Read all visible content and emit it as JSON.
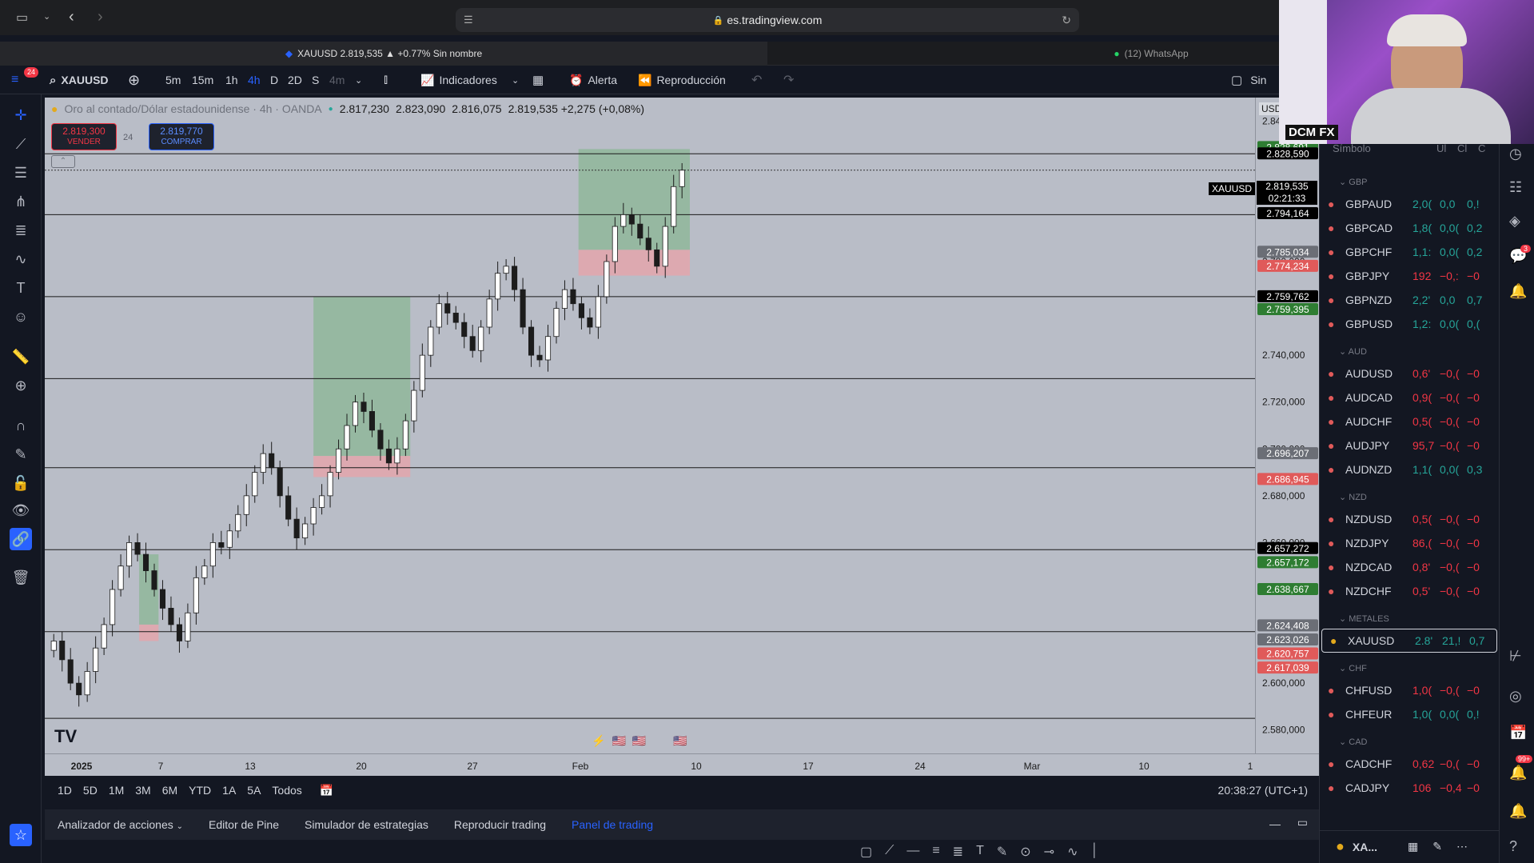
{
  "browser": {
    "url": "es.tradingview.com",
    "tabs": [
      {
        "label": "XAUUSD 2.819,535 ▲ +0.77% Sin nombre"
      },
      {
        "label": "(12) WhatsApp"
      }
    ]
  },
  "toolbar": {
    "notif_count": "24",
    "symbol": "XAUUSD",
    "intervals": [
      "5m",
      "15m",
      "1h",
      "4h",
      "D",
      "2D",
      "S",
      "4m"
    ],
    "active_interval": "4h",
    "indicators_label": "Indicadores",
    "alert_label": "Alerta",
    "replay_label": "Reproducción",
    "layout_label": "Sin"
  },
  "legend": {
    "title": "Oro al contado/Dólar estadounidense · 4h · OANDA",
    "open": "2.817,230",
    "high": "2.823,090",
    "low": "2.816,075",
    "close": "2.819,535 +2,275 (+0,08%)"
  },
  "trade": {
    "sell_price": "2.819,300",
    "sell_label": "VENDER",
    "spread": "24",
    "buy_price": "2.819,770",
    "buy_label": "COMPRAR"
  },
  "scale": {
    "currency": "USD",
    "symbol_tag": "XAUUSD",
    "current_price": "2.819,535",
    "countdown": "02:21:33"
  },
  "chart_data": {
    "type": "candlestick",
    "ylim": [
      2570,
      2850
    ],
    "yticks": [
      "2.840,000",
      "2.800,000",
      "2.780,000",
      "2.740,000",
      "2.720,000",
      "2.700,000",
      "2.680,000",
      "2.660,000",
      "2.600,000",
      "2.580,000"
    ],
    "xticks": [
      "2025",
      "7",
      "13",
      "20",
      "27",
      "Feb",
      "10",
      "17",
      "24",
      "Mar",
      "10",
      "1"
    ],
    "horizontal_levels": [
      2826,
      2800,
      2765,
      2730,
      2692,
      2657,
      2622,
      2585
    ],
    "price_labels": [
      {
        "text": "2.828,691",
        "value": 2828.7,
        "color": "#2e7d32"
      },
      {
        "text": "2.828,590",
        "value": 2826.0,
        "color": "#000000"
      },
      {
        "text": "2.794,164",
        "value": 2800.5,
        "color": "#000000"
      },
      {
        "text": "2.785,034",
        "value": 2784.0,
        "color": "#6b6e76"
      },
      {
        "text": "2.774,234",
        "value": 2778.0,
        "color": "#e05a5a"
      },
      {
        "text": "2.759,762",
        "value": 2765.0,
        "color": "#000000"
      },
      {
        "text": "2.759,395",
        "value": 2759.5,
        "color": "#2e7d32"
      },
      {
        "text": "2.696,207",
        "value": 2698.0,
        "color": "#6b6e76"
      },
      {
        "text": "2.686,945",
        "value": 2687.0,
        "color": "#e05a5a"
      },
      {
        "text": "2.657,272",
        "value": 2657.5,
        "color": "#000000"
      },
      {
        "text": "2.657,172",
        "value": 2651.5,
        "color": "#2e7d32"
      },
      {
        "text": "2.638,667",
        "value": 2640.0,
        "color": "#2e7d32"
      },
      {
        "text": "2.624,408",
        "value": 2624.5,
        "color": "#6b6e76"
      },
      {
        "text": "2.623,026",
        "value": 2618.5,
        "color": "#6b6e76"
      },
      {
        "text": "2.620,757",
        "value": 2612.5,
        "color": "#e05a5a"
      },
      {
        "text": "2.617,039",
        "value": 2606.5,
        "color": "#e05a5a"
      }
    ],
    "zones": [
      {
        "kind": "profit",
        "x0": 0.078,
        "x1": 0.094,
        "y0": 2655,
        "y1": 2625
      },
      {
        "kind": "loss",
        "x0": 0.078,
        "x1": 0.094,
        "y0": 2625,
        "y1": 2618
      },
      {
        "kind": "profit",
        "x0": 0.222,
        "x1": 0.302,
        "y0": 2765,
        "y1": 2697
      },
      {
        "kind": "loss",
        "x0": 0.222,
        "x1": 0.302,
        "y0": 2697,
        "y1": 2688
      },
      {
        "kind": "profit",
        "x0": 0.441,
        "x1": 0.533,
        "y0": 2828,
        "y1": 2785
      },
      {
        "kind": "loss",
        "x0": 0.441,
        "x1": 0.533,
        "y0": 2785,
        "y1": 2774
      }
    ],
    "close_series": [
      2618,
      2610,
      2600,
      2595,
      2605,
      2615,
      2625,
      2640,
      2650,
      2660,
      2655,
      2648,
      2640,
      2632,
      2625,
      2618,
      2630,
      2645,
      2650,
      2660,
      2658,
      2665,
      2672,
      2680,
      2690,
      2698,
      2692,
      2680,
      2670,
      2662,
      2668,
      2675,
      2680,
      2690,
      2700,
      2710,
      2720,
      2716,
      2708,
      2700,
      2694,
      2700,
      2712,
      2725,
      2740,
      2752,
      2762,
      2758,
      2754,
      2748,
      2742,
      2752,
      2764,
      2775,
      2778,
      2768,
      2752,
      2740,
      2738,
      2748,
      2760,
      2768,
      2762,
      2756,
      2752,
      2765,
      2780,
      2795,
      2800,
      2796,
      2790,
      2785,
      2778,
      2795,
      2812,
      2819
    ]
  },
  "range_bar": {
    "ranges": [
      "1D",
      "5D",
      "1M",
      "3M",
      "6M",
      "YTD",
      "1A",
      "5A",
      "Todos"
    ],
    "clock": "20:38:27 (UTC+1)"
  },
  "bottom_tabs": [
    "Analizador de acciones",
    "Editor de Pine",
    "Simulador de estrategias",
    "Reproducir trading",
    "Panel de trading"
  ],
  "active_bottom_tab": "Panel de trading",
  "webcam": {
    "label": "DCM FX"
  },
  "watchlist": {
    "header": {
      "symbol": "Símbolo",
      "c1": "Úl",
      "c2": "Cl",
      "c3": "C"
    },
    "groups": [
      {
        "name": "GBP",
        "items": [
          {
            "symbol": "GBPAUD",
            "last": "2,0(",
            "chg": "0,0",
            "pct": "0,!",
            "color": "#26a69a"
          },
          {
            "symbol": "GBPCAD",
            "last": "1,8(",
            "chg": "0,0(",
            "pct": "0,2",
            "color": "#26a69a"
          },
          {
            "symbol": "GBPCHF",
            "last": "1,1:",
            "chg": "0,0(",
            "pct": "0,2",
            "color": "#26a69a"
          },
          {
            "symbol": "GBPJPY",
            "last": "192",
            "chg": "−0,:",
            "pct": "−0",
            "color": "#f23645"
          },
          {
            "symbol": "GBPNZD",
            "last": "2,2'",
            "chg": "0,0",
            "pct": "0,7",
            "color": "#26a69a"
          },
          {
            "symbol": "GBPUSD",
            "last": "1,2:",
            "chg": "0,0(",
            "pct": "0,(",
            "color": "#26a69a"
          }
        ]
      },
      {
        "name": "AUD",
        "items": [
          {
            "symbol": "AUDUSD",
            "last": "0,6'",
            "chg": "−0,(",
            "pct": "−0",
            "color": "#f23645"
          },
          {
            "symbol": "AUDCAD",
            "last": "0,9(",
            "chg": "−0,(",
            "pct": "−0",
            "color": "#f23645"
          },
          {
            "symbol": "AUDCHF",
            "last": "0,5(",
            "chg": "−0,(",
            "pct": "−0",
            "color": "#f23645"
          },
          {
            "symbol": "AUDJPY",
            "last": "95,7",
            "chg": "−0,(",
            "pct": "−0",
            "color": "#f23645"
          },
          {
            "symbol": "AUDNZD",
            "last": "1,1(",
            "chg": "0,0(",
            "pct": "0,3",
            "color": "#26a69a"
          }
        ]
      },
      {
        "name": "NZD",
        "items": [
          {
            "symbol": "NZDUSD",
            "last": "0,5(",
            "chg": "−0,(",
            "pct": "−0",
            "color": "#f23645"
          },
          {
            "symbol": "NZDJPY",
            "last": "86,(",
            "chg": "−0,(",
            "pct": "−0",
            "color": "#f23645"
          },
          {
            "symbol": "NZDCAD",
            "last": "0,8'",
            "chg": "−0,(",
            "pct": "−0",
            "color": "#f23645"
          },
          {
            "symbol": "NZDCHF",
            "last": "0,5'",
            "chg": "−0,(",
            "pct": "−0",
            "color": "#f23645"
          }
        ]
      },
      {
        "name": "METALES",
        "items": [
          {
            "symbol": "XAUUSD",
            "last": "2.8'",
            "chg": "21,!",
            "pct": "0,7",
            "color": "#26a69a"
          }
        ]
      },
      {
        "name": "CHF",
        "items": [
          {
            "symbol": "CHFUSD",
            "last": "1,0(",
            "chg": "−0,(",
            "pct": "−0",
            "color": "#f23645"
          },
          {
            "symbol": "CHFEUR",
            "last": "1,0(",
            "chg": "0,0(",
            "pct": "0,!",
            "color": "#26a69a"
          }
        ]
      },
      {
        "name": "CAD",
        "items": [
          {
            "symbol": "CADCHF",
            "last": "0,62",
            "chg": "−0,(",
            "pct": "−0",
            "color": "#f23645"
          },
          {
            "symbol": "CADJPY",
            "last": "106",
            "chg": "−0,4",
            "pct": "−0",
            "color": "#f23645"
          }
        ]
      }
    ],
    "footer_symbol": "XA..."
  },
  "right_tools": {
    "badge_chat": "3",
    "badge_calendar": "99+"
  }
}
